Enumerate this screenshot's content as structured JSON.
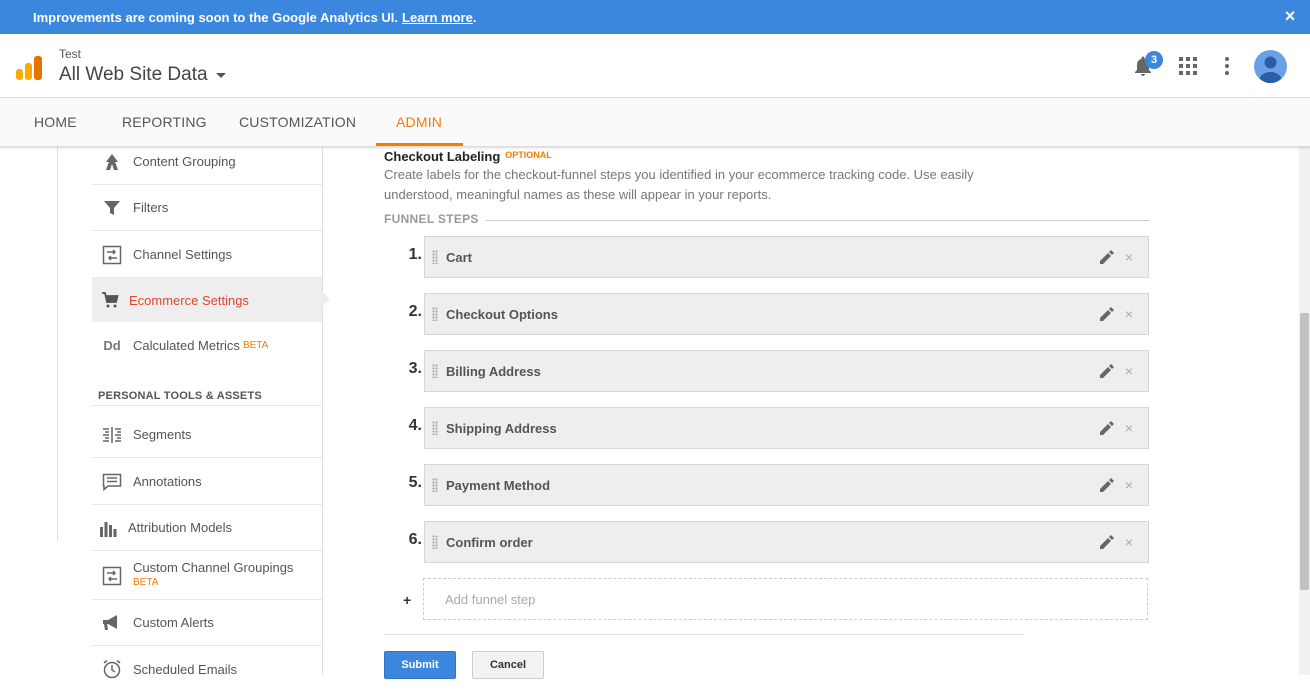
{
  "banner": {
    "text": "Improvements are coming soon to the Google Analytics UI.",
    "link": "Learn more",
    "suffix": ".",
    "close_icon": "×"
  },
  "header": {
    "account_small": "Test",
    "account_big": "All Web Site Data",
    "notification_count": "3"
  },
  "nav": {
    "tabs": [
      {
        "label": "HOME"
      },
      {
        "label": "REPORTING"
      },
      {
        "label": "CUSTOMIZATION"
      },
      {
        "label": "ADMIN"
      }
    ],
    "active": "ADMIN",
    "accent_color": "#f57c00"
  },
  "sidebar": {
    "items": [
      {
        "label": "Content Grouping",
        "icon": "content-grouping-icon"
      },
      {
        "label": "Filters",
        "icon": "filter-icon"
      },
      {
        "label": "Channel Settings",
        "icon": "channel-settings-icon"
      },
      {
        "label": "Ecommerce Settings",
        "icon": "cart-icon"
      },
      {
        "label": "Calculated Metrics",
        "icon": "calculated-metrics-icon",
        "badge": "BETA"
      }
    ],
    "section_title": "PERSONAL TOOLS & ASSETS",
    "tools": [
      {
        "label": "Segments",
        "icon": "segments-icon"
      },
      {
        "label": "Annotations",
        "icon": "annotations-icon"
      },
      {
        "label": "Attribution Models",
        "icon": "attribution-icon"
      },
      {
        "label": "Custom Channel Groupings",
        "icon": "channel-settings-icon",
        "badge": "BETA"
      },
      {
        "label": "Custom Alerts",
        "icon": "megaphone-icon"
      },
      {
        "label": "Scheduled Emails",
        "icon": "clock-icon"
      }
    ],
    "active_color": "#e0452f",
    "calc_icon_text": "Dd"
  },
  "main": {
    "title": "Checkout Labeling",
    "optional": "OPTIONAL",
    "description": "Create labels for the checkout-funnel steps you identified in your ecommerce tracking code. Use easily understood, meaningful names as these will appear in your reports.",
    "funnel_label": "FUNNEL STEPS",
    "steps": [
      {
        "num": "1.",
        "label": "Cart"
      },
      {
        "num": "2.",
        "label": "Checkout Options"
      },
      {
        "num": "3.",
        "label": "Billing Address"
      },
      {
        "num": "4.",
        "label": "Shipping Address"
      },
      {
        "num": "5.",
        "label": "Payment Method"
      },
      {
        "num": "6.",
        "label": "Confirm order"
      }
    ],
    "add_plus": "+",
    "add_placeholder": "Add funnel step",
    "submit": "Submit",
    "cancel": "Cancel",
    "primary_color": "#3b87de"
  }
}
